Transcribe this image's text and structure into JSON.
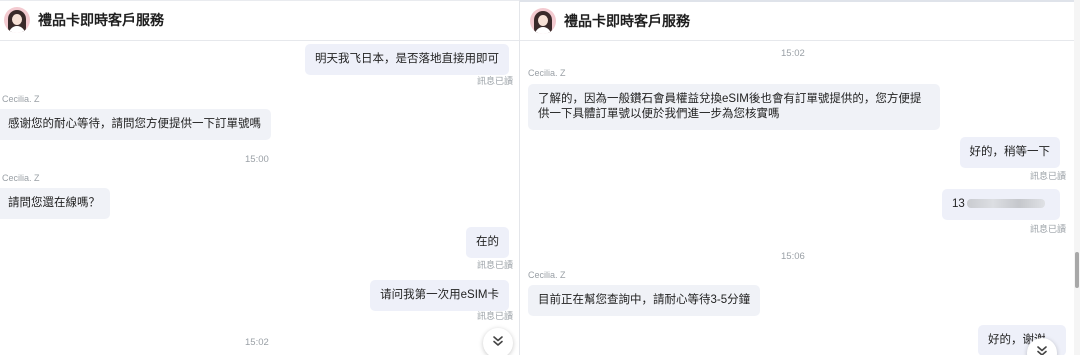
{
  "left": {
    "header": {
      "title": "禮品卡即時客戶服務"
    },
    "messages": [
      {
        "text": "明天我飞日本，是否落地直接用即可",
        "read": "訊息已讀"
      },
      {
        "sender": "Cecilia. Z",
        "text": "感谢您的耐心等待，請問您方便提供一下訂單號嗎"
      },
      {
        "time": "15:00"
      },
      {
        "sender": "Cecilia. Z",
        "text": "請問您還在線嗎？"
      },
      {
        "text": "在的",
        "read": "訊息已讀"
      },
      {
        "text": "请问我第一次用eSIM卡",
        "read": "訊息已讀"
      },
      {
        "time": "15:02"
      }
    ],
    "scroll_button": {
      "icon": "double-chevron-down-icon"
    }
  },
  "right": {
    "header": {
      "title": "禮品卡即時客戶服務"
    },
    "messages": [
      {
        "time": "15:02"
      },
      {
        "sender": "Cecilia. Z",
        "text": "了解的，因為一般鑽石會員權益兌換eSIM後也會有訂單號提供的，您方便提供一下具體訂單號以便於我們進一步為您核實嗎"
      },
      {
        "text": "好的，稍等一下",
        "read": "訊息已讀"
      },
      {
        "text": "13",
        "read": "訊息已讀"
      },
      {
        "time": "15:06"
      },
      {
        "sender": "Cecilia. Z",
        "text": "目前正在幫您查詢中，請耐心等待3-5分鐘"
      },
      {
        "text": "好的，谢谢"
      }
    ],
    "scroll_button": {
      "icon": "double-chevron-down-icon"
    }
  },
  "colors": {
    "bubble": "#f0f2f7",
    "meta_text": "#9aa0a6",
    "avatar_bg": "#f3cad0"
  }
}
